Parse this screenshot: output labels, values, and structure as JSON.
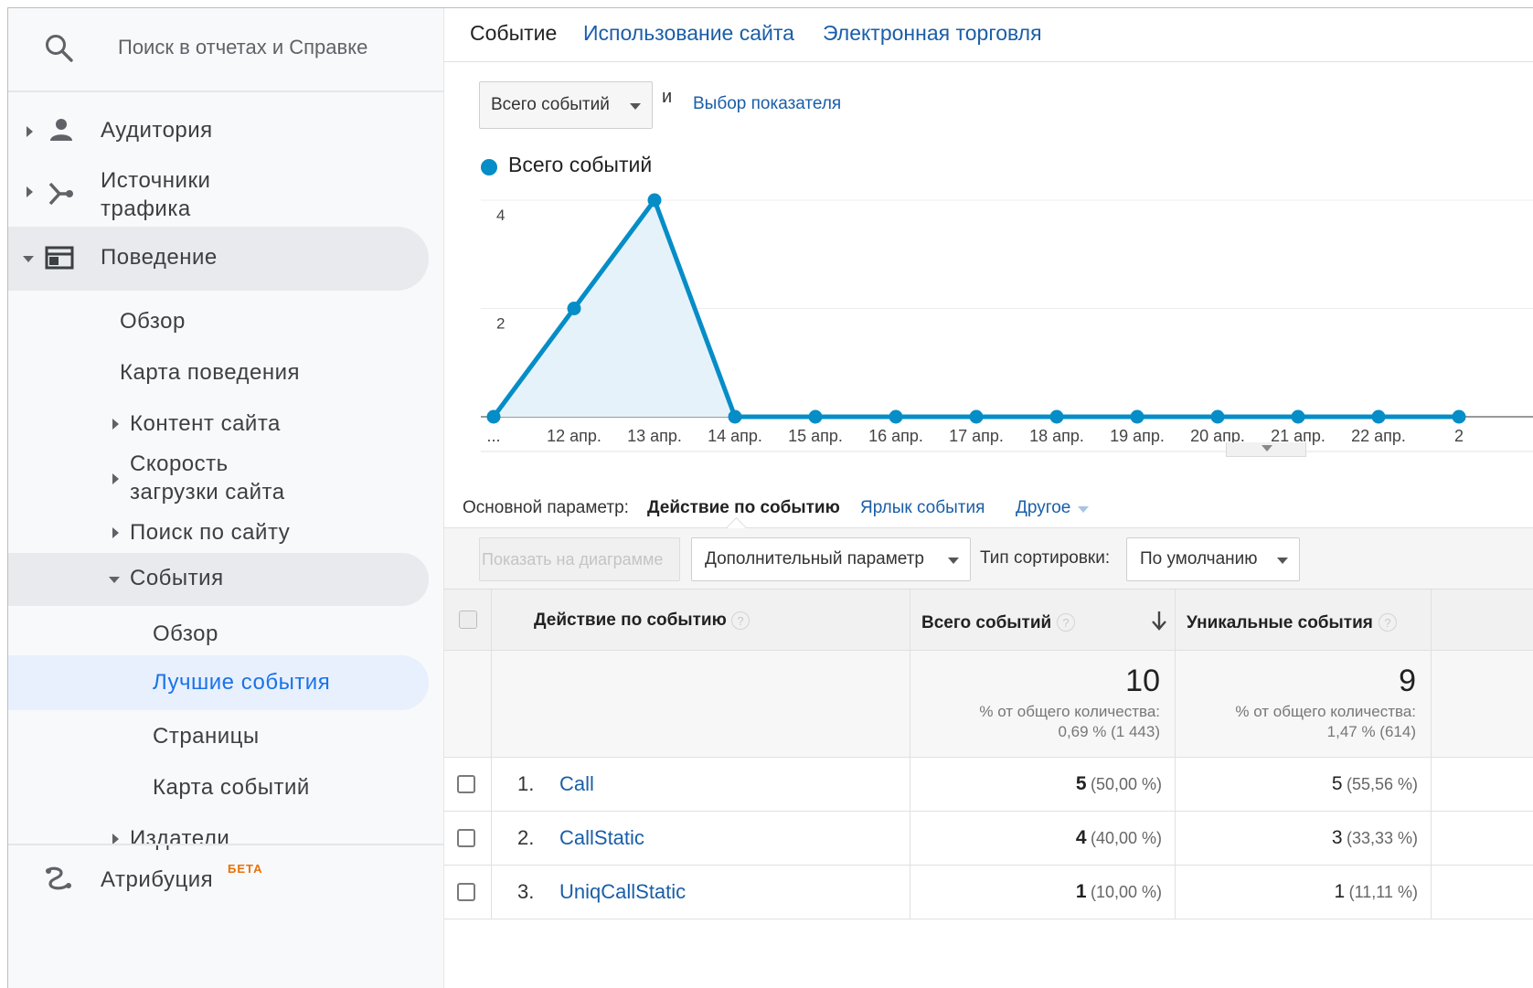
{
  "sidebar": {
    "search_placeholder": "Поиск в отчетах и Справке",
    "audience": "Аудитория",
    "traffic_sources_line1": "Источники",
    "traffic_sources_line2": "трафика",
    "behavior": "Поведение",
    "overview": "Обзор",
    "behavior_flow": "Карта поведения",
    "site_content": "Контент сайта",
    "site_speed_line1": "Скорость",
    "site_speed_line2": "загрузки сайта",
    "site_search": "Поиск по сайту",
    "events": "События",
    "events_overview": "Обзор",
    "top_events": "Лучшие события",
    "pages": "Страницы",
    "events_flow": "Карта событий",
    "publishers": "Издатели",
    "attribution": "Атрибуция",
    "beta": "БЕТА"
  },
  "tabs": [
    "Событие",
    "Использование сайта",
    "Электронная торговля"
  ],
  "metric_select": "Всего событий",
  "and_text": "и",
  "metric_picker": "Выбор показателя",
  "legend": "Всего событий",
  "colors": {
    "series": "#058dc7",
    "link": "#1a5ea8",
    "active_nav": "#1a73e8",
    "beta": "#e8710a"
  },
  "chart_data": {
    "type": "area",
    "series": [
      {
        "name": "Всего событий",
        "values": [
          0,
          2,
          4,
          0,
          0,
          0,
          0,
          0,
          0,
          0,
          0,
          0,
          0
        ]
      }
    ],
    "categories": [
      "...",
      "12 апр.",
      "13 апр.",
      "14 апр.",
      "15 апр.",
      "16 апр.",
      "17 апр.",
      "18 апр.",
      "19 апр.",
      "20 апр.",
      "21 апр.",
      "22 апр.",
      "2"
    ],
    "yticks": [
      "2",
      "4"
    ],
    "ylim": [
      0,
      4
    ],
    "grid": true,
    "legend_position": "top-left"
  },
  "dimension_row": {
    "label": "Основной параметр:",
    "active": "Действие по событию",
    "event_label": "Ярлык события",
    "other": "Другое"
  },
  "toolbar": {
    "plot_rows": "Показать на диаграмме",
    "secondary_dimension": "Дополнительный параметр",
    "sort_type_label": "Тип сортировки:",
    "sort_default": "По умолчанию"
  },
  "table": {
    "headers": {
      "action": "Действие по событию",
      "total": "Всего событий",
      "unique": "Уникальные события"
    },
    "totals": {
      "total_value": "10",
      "total_pct_label": "% от общего количества:",
      "total_pct": "0,69 % (1 443)",
      "unique_value": "9",
      "unique_pct_label": "% от общего количества:",
      "unique_pct": "1,47 % (614)"
    },
    "rows": [
      {
        "num": "1.",
        "name": "Call",
        "total": "5",
        "total_pct": "(50,00 %)",
        "unique": "5",
        "unique_pct": "(55,56 %)"
      },
      {
        "num": "2.",
        "name": "CallStatic",
        "total": "4",
        "total_pct": "(40,00 %)",
        "unique": "3",
        "unique_pct": "(33,33 %)"
      },
      {
        "num": "3.",
        "name": "UniqCallStatic",
        "total": "1",
        "total_pct": "(10,00 %)",
        "unique": "1",
        "unique_pct": "(11,11 %)"
      }
    ]
  }
}
